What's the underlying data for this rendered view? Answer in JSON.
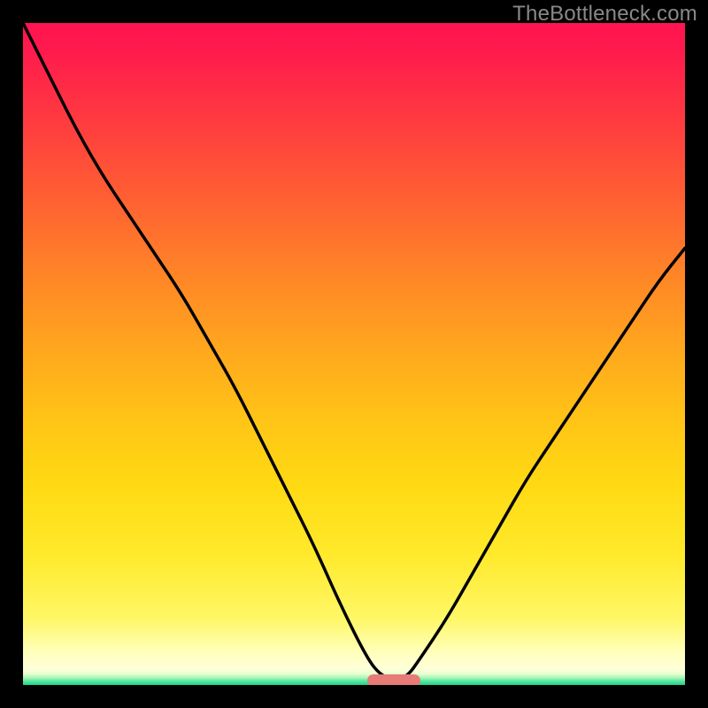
{
  "watermark": "TheBottleneck.com",
  "chart_data": {
    "type": "line",
    "title": "",
    "xlabel": "",
    "ylabel": "",
    "xlim": [
      0,
      100
    ],
    "ylim": [
      0,
      100
    ],
    "grid": false,
    "description": "V-shaped bottleneck curve on red-to-green vertical gradient. Minimum (0% bottleneck) near x≈56; values rise steeply toward 100% at both ends.",
    "series": [
      {
        "name": "bottleneck-curve",
        "x": [
          0,
          4,
          8,
          12,
          16,
          20,
          24,
          28,
          32,
          36,
          40,
          44,
          48,
          52,
          54,
          56,
          58,
          60,
          64,
          68,
          72,
          76,
          80,
          84,
          88,
          92,
          96,
          100
        ],
        "values": [
          100,
          92,
          84,
          77,
          71,
          65,
          59,
          52,
          45,
          37,
          29,
          21,
          12,
          4,
          1.5,
          0.8,
          1.2,
          4,
          10,
          17,
          24,
          31,
          37,
          43,
          49,
          55,
          61,
          66
        ]
      }
    ],
    "minimum_marker": {
      "x_start": 52,
      "x_end": 60,
      "y": 0.7,
      "color": "#e77c76"
    },
    "gradient_stops": [
      {
        "pct": 0,
        "color": "#ff1450"
      },
      {
        "pct": 50,
        "color": "#ffa91d"
      },
      {
        "pct": 90,
        "color": "#fff766"
      },
      {
        "pct": 100,
        "color": "#18d48a"
      }
    ]
  }
}
